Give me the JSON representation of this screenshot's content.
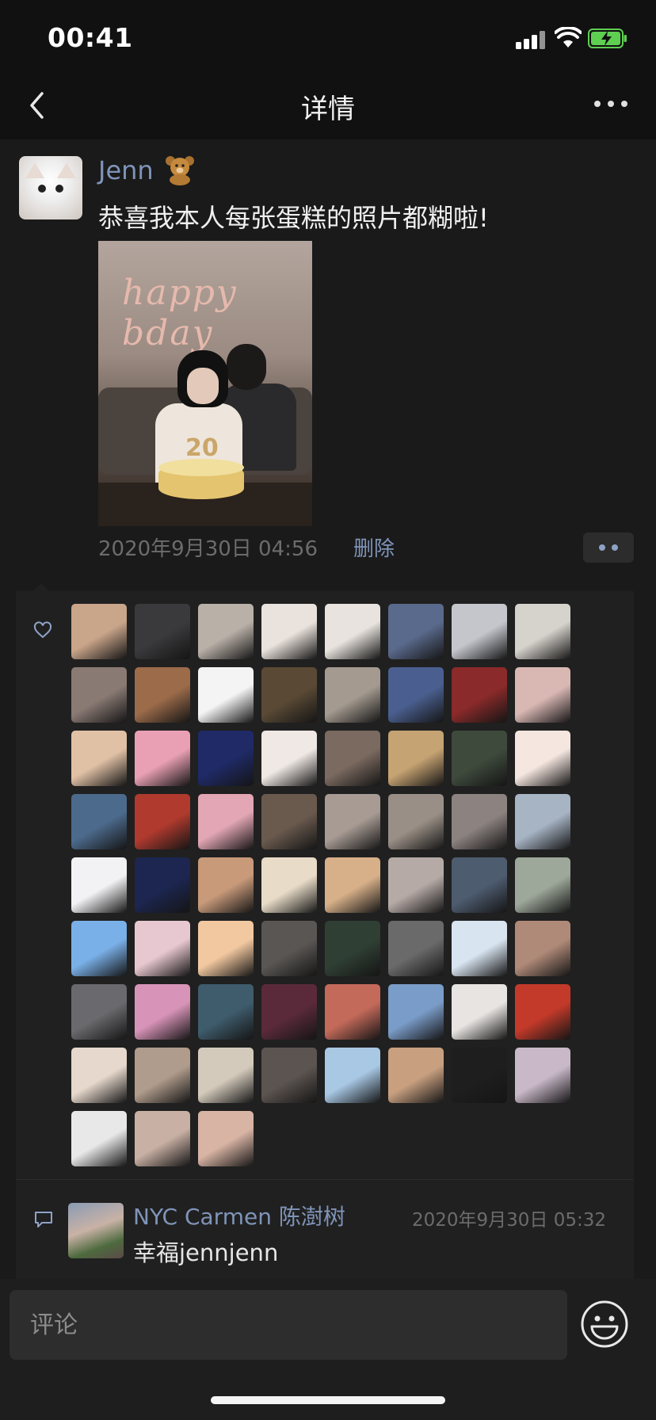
{
  "status_bar": {
    "time": "00:41"
  },
  "nav": {
    "title": "详情"
  },
  "post": {
    "author": "Jenn",
    "author_emoji_icon": "bear-emoji-icon",
    "text": "恭喜我本人每张蛋糕的照片都糊啦!",
    "photo_text": "happy bday",
    "candle_text": "20",
    "time": "2020年9月30日 04:56",
    "delete_label": "删除"
  },
  "likes": {
    "icon": "heart-icon",
    "count": 67,
    "palette": [
      [
        "#c9a58a",
        "#3a3a3c",
        "#b9b0a8",
        "#eae2dc",
        "#e8e3de",
        "#5a6a8c",
        "#c4c6cc",
        "#d6d2cc"
      ],
      [
        "#8a7a74",
        "#9c6b4a",
        "#f4f4f4",
        "#5a4a35",
        "#a49a8f",
        "#4a5f8f",
        "#8b2a2a",
        "#d9b8b4"
      ],
      [
        "#e0c1a6",
        "#e9a0b4",
        "#1f2a66",
        "#efe8e4",
        "#7b6a60",
        "#c6a372",
        "#3e4a3c",
        "#f5e6e0"
      ],
      [
        "#4c6a8c",
        "#b03a2e",
        "#e2a6b4",
        "#6a5a4e",
        "#a89b94",
        "#9a8f86",
        "#8c8280",
        "#a7b4c4"
      ],
      [
        "#f2f2f4",
        "#1c2650",
        "#c89a7a",
        "#e8dcc8",
        "#d7b089",
        "#b6aaa6",
        "#4e5c70",
        "#9ea89a"
      ],
      [
        "#7ab0e8",
        "#e8c8d0",
        "#f2c8a0",
        "#5a5654",
        "#2f3f34",
        "#6a6a6a",
        "#d8e4f0",
        "#b08a78"
      ],
      [
        "#6a6a6e",
        "#d894b8",
        "#3f5c6c",
        "#5a2a3a",
        "#c46a5a",
        "#7a9cc8",
        "#e8e4e2",
        "#c43a2a"
      ],
      [
        "#e6d8cc",
        "#b09c8c",
        "#d4cabc",
        "#5c5450",
        "#a8c8e4",
        "#c8a080",
        "#1e1e1e",
        "#c8b8c8"
      ],
      [
        "#e8e8e8",
        "#c8b0a4",
        "#d8b4a4"
      ]
    ]
  },
  "comment": {
    "icon": "comment-icon",
    "author": "NYC Carmen 陈澍树",
    "time": "2020年9月30日 05:32",
    "text": "幸福jennjenn"
  },
  "input": {
    "placeholder": "评论"
  }
}
